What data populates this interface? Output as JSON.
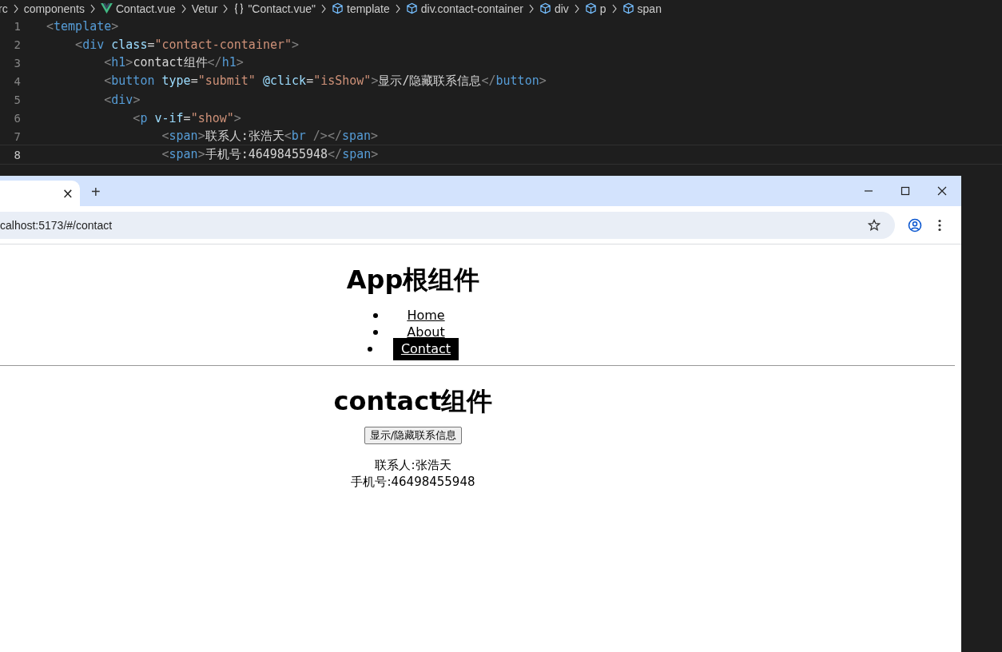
{
  "editor": {
    "breadcrumbs": [
      {
        "kind": "text",
        "label": "rc"
      },
      {
        "kind": "text",
        "label": "components"
      },
      {
        "kind": "vue",
        "label": "Contact.vue"
      },
      {
        "kind": "text",
        "label": "Vetur"
      },
      {
        "kind": "braces",
        "label": "\"Contact.vue\""
      },
      {
        "kind": "cube",
        "label": "template"
      },
      {
        "kind": "cube",
        "label": "div.contact-container"
      },
      {
        "kind": "cube",
        "label": "div"
      },
      {
        "kind": "cube",
        "label": "p"
      },
      {
        "kind": "cube",
        "label": "span"
      }
    ],
    "lines": [
      {
        "number": "1",
        "current": false,
        "tokens": [
          {
            "kind": "punct",
            "text": "<"
          },
          {
            "kind": "tag",
            "text": "template"
          },
          {
            "kind": "punct",
            "text": ">"
          }
        ]
      },
      {
        "number": "2",
        "current": false,
        "tokens": [
          {
            "kind": "punct",
            "text": "    <"
          },
          {
            "kind": "tag",
            "text": "div"
          },
          {
            "kind": "attr",
            "text": " class"
          },
          {
            "kind": "text",
            "text": "="
          },
          {
            "kind": "str",
            "text": "\"contact-container\""
          },
          {
            "kind": "punct",
            "text": ">"
          }
        ]
      },
      {
        "number": "3",
        "current": false,
        "tokens": [
          {
            "kind": "punct",
            "text": "        <"
          },
          {
            "kind": "tag",
            "text": "h1"
          },
          {
            "kind": "punct",
            "text": ">"
          },
          {
            "kind": "text",
            "text": "contact组件"
          },
          {
            "kind": "punct",
            "text": "</"
          },
          {
            "kind": "tag",
            "text": "h1"
          },
          {
            "kind": "punct",
            "text": ">"
          }
        ]
      },
      {
        "number": "4",
        "current": false,
        "tokens": [
          {
            "kind": "punct",
            "text": "        <"
          },
          {
            "kind": "tag",
            "text": "button"
          },
          {
            "kind": "attr",
            "text": " type"
          },
          {
            "kind": "text",
            "text": "="
          },
          {
            "kind": "str",
            "text": "\"submit\""
          },
          {
            "kind": "attr",
            "text": " @click"
          },
          {
            "kind": "text",
            "text": "="
          },
          {
            "kind": "str",
            "text": "\"isShow\""
          },
          {
            "kind": "punct",
            "text": ">"
          },
          {
            "kind": "text",
            "text": "显示/隐藏联系信息"
          },
          {
            "kind": "punct",
            "text": "</"
          },
          {
            "kind": "tag",
            "text": "button"
          },
          {
            "kind": "punct",
            "text": ">"
          }
        ]
      },
      {
        "number": "5",
        "current": false,
        "tokens": [
          {
            "kind": "punct",
            "text": "        <"
          },
          {
            "kind": "tag",
            "text": "div"
          },
          {
            "kind": "punct",
            "text": ">"
          }
        ]
      },
      {
        "number": "6",
        "current": false,
        "tokens": [
          {
            "kind": "punct",
            "text": "            <"
          },
          {
            "kind": "tag",
            "text": "p"
          },
          {
            "kind": "attr",
            "text": " v-if"
          },
          {
            "kind": "text",
            "text": "="
          },
          {
            "kind": "str",
            "text": "\"show\""
          },
          {
            "kind": "punct",
            "text": ">"
          }
        ]
      },
      {
        "number": "7",
        "current": false,
        "tokens": [
          {
            "kind": "punct",
            "text": "                <"
          },
          {
            "kind": "tag",
            "text": "span"
          },
          {
            "kind": "punct",
            "text": ">"
          },
          {
            "kind": "text",
            "text": "联系人:张浩天"
          },
          {
            "kind": "punct",
            "text": "<"
          },
          {
            "kind": "tag",
            "text": "br"
          },
          {
            "kind": "punct",
            "text": " /></"
          },
          {
            "kind": "tag",
            "text": "span"
          },
          {
            "kind": "punct",
            "text": ">"
          }
        ]
      },
      {
        "number": "8",
        "current": true,
        "tokens": [
          {
            "kind": "punct",
            "text": "                <"
          },
          {
            "kind": "tag",
            "text": "span"
          },
          {
            "kind": "punct",
            "text": ">"
          },
          {
            "kind": "text",
            "text": "手机号:46498455948"
          },
          {
            "kind": "punct",
            "text": "</"
          },
          {
            "kind": "tag",
            "text": "span"
          },
          {
            "kind": "punct",
            "text": ">"
          }
        ]
      }
    ]
  },
  "browser": {
    "tab": {
      "close": "×"
    },
    "new_tab": "+",
    "address": "calhost:5173/#/contact",
    "page": {
      "title": "App根组件",
      "nav": [
        {
          "label": "Home",
          "selected": false
        },
        {
          "label": "About",
          "selected": false
        },
        {
          "label": "Contact",
          "selected": true
        }
      ],
      "heading": "contact组件",
      "button": "显示/隐藏联系信息",
      "contact_lines": [
        "联系人:张浩天",
        "手机号:46498455948"
      ]
    }
  }
}
